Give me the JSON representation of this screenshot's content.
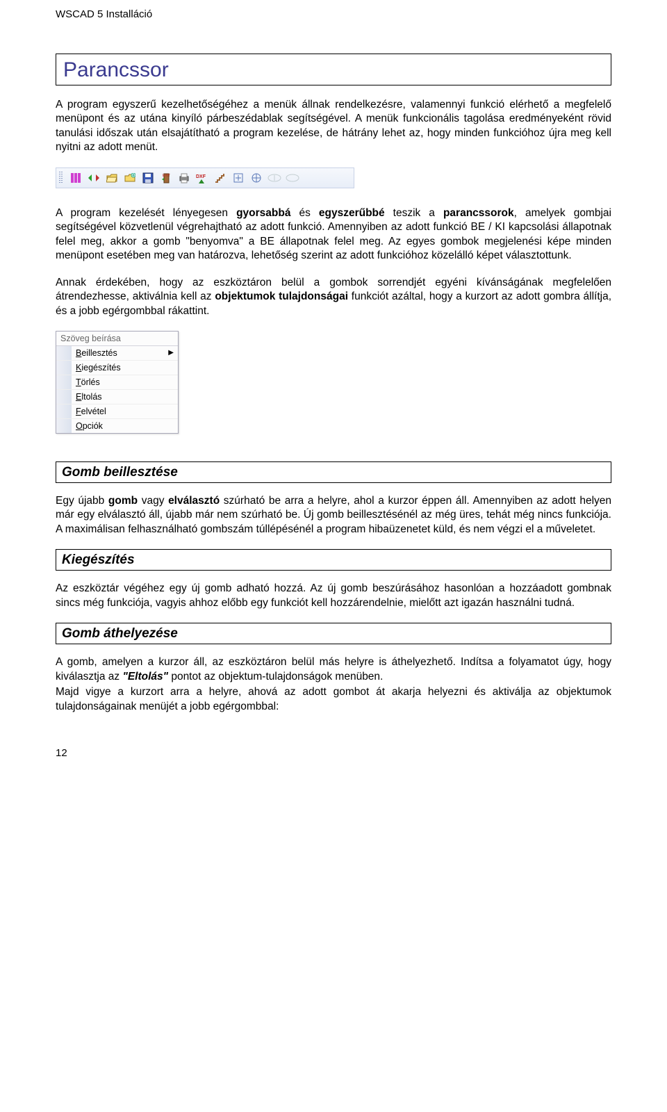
{
  "header": "WSCAD 5 Installáció",
  "title": "Parancssor",
  "para1_a": "A program egyszerű kezelhetőségéhez a menük állnak rendelkezésre, valamennyi funkció elérhető a megfelelő menüpont és az utána kinyíló párbeszédablak segítségével. A menük funkcionális tagolása eredményeként rövid tanulási időszak után elsajátítható a program kezelése, de hátrány lehet az, hogy minden funkcióhoz újra meg kell nyitni az adott menüt.",
  "para2_a": "A program kezelését lényegesen ",
  "para2_b": "gyorsabbá",
  "para2_c": " és ",
  "para2_d": "egyszerűbbé",
  "para2_e": " teszik a ",
  "para2_f": "parancssorok",
  "para2_g": ", amelyek gombjai segítségével közvetlenül végrehajtható az adott funkció. Amennyiben az adott funkció BE / KI kapcsolási állapotnak felel meg, akkor a gomb \"benyomva\" a BE állapotnak felel meg. Az egyes gombok megjelenési képe minden menüpont esetében meg van határozva, lehetőség szerint az adott funkcióhoz közelálló képet választottunk.",
  "para3_a": "Annak érdekében, hogy az eszköztáron belül a gombok sorrendjét egyéni kívánságának megfelelően átrendezhesse, aktiválnia kell az ",
  "para3_b": "objektumok tulajdonságai",
  "para3_c": " funkciót azáltal, hogy a kurzort az adott gombra állítja, és a jobb egérgombbal rákattint.",
  "ctx": {
    "header": "Szöveg beírása",
    "items": [
      {
        "u": "B",
        "rest": "eillesztés",
        "sub": true
      },
      {
        "u": "K",
        "rest": "iegészítés"
      },
      {
        "u": "T",
        "rest": "örlés"
      },
      {
        "u": "E",
        "rest": "ltolás"
      },
      {
        "u": "F",
        "rest": "elvétel"
      },
      {
        "u": "O",
        "rest": "pciók"
      }
    ]
  },
  "sec1": {
    "title": "Gomb beillesztése"
  },
  "sec1_p_a": "Egy újabb ",
  "sec1_p_b": "gomb",
  "sec1_p_c": " vagy ",
  "sec1_p_d": "elválasztó",
  "sec1_p_e": " szúrható be arra a helyre, ahol a kurzor éppen áll. Amennyiben az adott helyen már egy elválasztó áll, újabb már nem szúrható be. Új gomb beillesztésénél az még üres, tehát még nincs funkciója. A maximálisan felhasználható gombszám túllépésénél a program hibaüzenetet küld, és nem végzi el a műveletet.",
  "sec2": {
    "title": "Kiegészítés"
  },
  "sec2_p": "Az eszköztár végéhez egy új gomb adható hozzá. Az új gomb beszúrásához hasonlóan a hozzáadott gombnak sincs még funkciója, vagyis ahhoz előbb egy funkciót kell hozzárendelnie, mielőtt azt igazán használni tudná.",
  "sec3": {
    "title": "Gomb áthelyezése"
  },
  "sec3_p_a": "A gomb, amelyen a kurzor áll, az eszköztáron belül más helyre is áthelyezhető. Indítsa a folyamatot úgy, hogy kiválasztja az ",
  "sec3_p_b": "\"Eltolás\"",
  "sec3_p_c": " pontot az objektum-tulajdonságok menüben.",
  "sec3_p2": "Majd vigye a kurzort arra a helyre, ahová az adott gombot át akarja helyezni és aktiválja az objektumok tulajdonságainak menüjét a jobb egérgombbal:",
  "page_number": "12"
}
